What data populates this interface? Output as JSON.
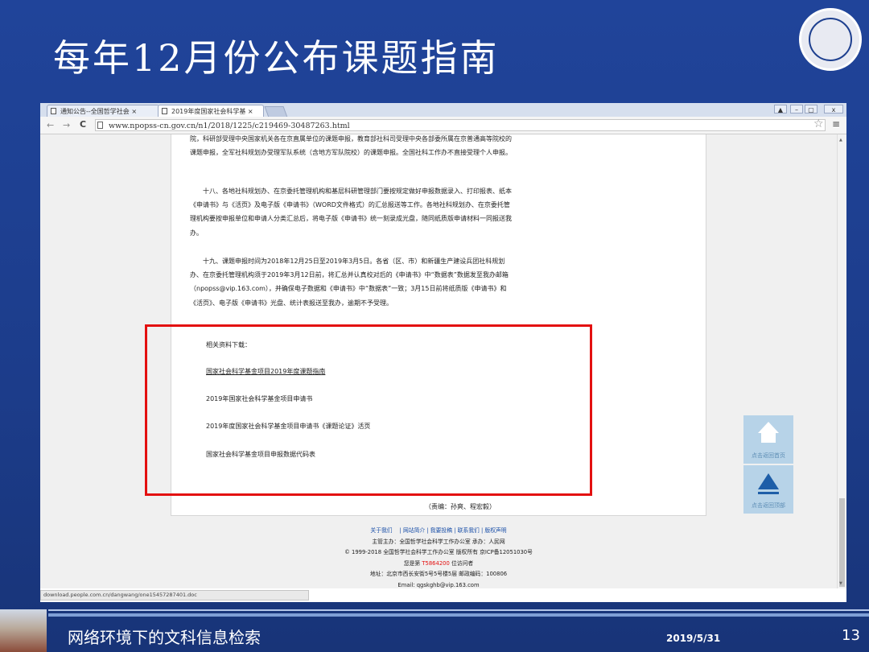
{
  "slide": {
    "title": "每年12月份公布课题指南",
    "footer_title": "网络环境下的文科信息检索",
    "date": "2019/5/31",
    "page_number": "13"
  },
  "browser": {
    "tabs": [
      {
        "label": "通知公告--全国哲学社会 ×",
        "active": false
      },
      {
        "label": "2019年度国家社会科学基 ×",
        "active": true
      }
    ],
    "window_controls": [
      "▲",
      "–",
      "▢",
      "x"
    ],
    "nav": {
      "back": "←",
      "forward": "→",
      "reload": "C"
    },
    "url": "www.npopss-cn.gov.cn/n1/2018/1225/c219469-30487263.html",
    "status_url": "download.people.com.cn/dangwang/one15457287401.doc"
  },
  "article": {
    "paragraphs": [
      "院，科研部受理中央国家机关各在京直属单位的课题申报，教育部社科司受理中央各部委所属在京普通高等院校的课题申报，全军社科规划办受理军队系统（含地方军队院校）的课题申报。全国社科工作办不直接受理个人申报。",
      "十八、各地社科规划办、在京委托管理机构和基层科研管理部门要按规定做好申报数据录入、打印报表、纸本《申请书》与《活页》及电子版《申请书》（WORD文件格式）的汇总报送等工作。各地社科规划办、在京委托管理机构要按申报单位和申请人分类汇总后，将电子版《申请书》统一刻录成光盘，随同纸质版申请材料一同报送我办。",
      "十九、课题申报时间为2018年12月25日至2019年3月5日。各省（区、市）和新疆生产建设兵团社科规划办、在京委托管理机构须于2019年3月12日前，将汇总并认真校对后的《申请书》中“数据表”数据发至我办邮箱（npopss@vip.163.com），并确保电子数据和《申请书》中“数据表”一致；3月15日前将纸质版《申请书》和《活页》、电子版《申请书》光盘、统计表报送至我办，逾期不予受理。"
    ],
    "downloads_label": "相关资料下载：",
    "downloads": [
      "国家社会科学基金项目2019年度课题指南",
      "2019年国家社会科学基金项目申请书",
      "2019年度国家社会科学基金项目申请书《课题论证》活页",
      "国家社会科学基金项目申报数据代码表"
    ],
    "editor": "（责编：孙爽、程宏毅）"
  },
  "footer": {
    "links": "关于我们 　| 网站简介 | 我要投稿 | 联系我们 | 版权声明",
    "host": "主管主办：全国哲学社会科学工作办公室 承办：人民网",
    "copyright": "© 1999-2018 全国哲学社会科学工作办公室 版权所有 京ICP备12051030号",
    "visitor_prefix": "您是第",
    "visitor_count": "T5864200",
    "visitor_suffix": "位访问者",
    "address": "地址：北京市西长安街5号5号楼5层 邮政编码：100806",
    "email": "Email: qgskghb@vip.163.com"
  },
  "side_buttons": [
    {
      "label": "点击返回首页",
      "icon": "home-icon"
    },
    {
      "label": "点击返回顶部",
      "icon": "up-arrow-icon"
    }
  ],
  "colors": {
    "slide_background": "#1d3f8f",
    "highlight_box": "#e31010",
    "side_button": "#b7d3e8",
    "link": "#1a4fa8"
  }
}
